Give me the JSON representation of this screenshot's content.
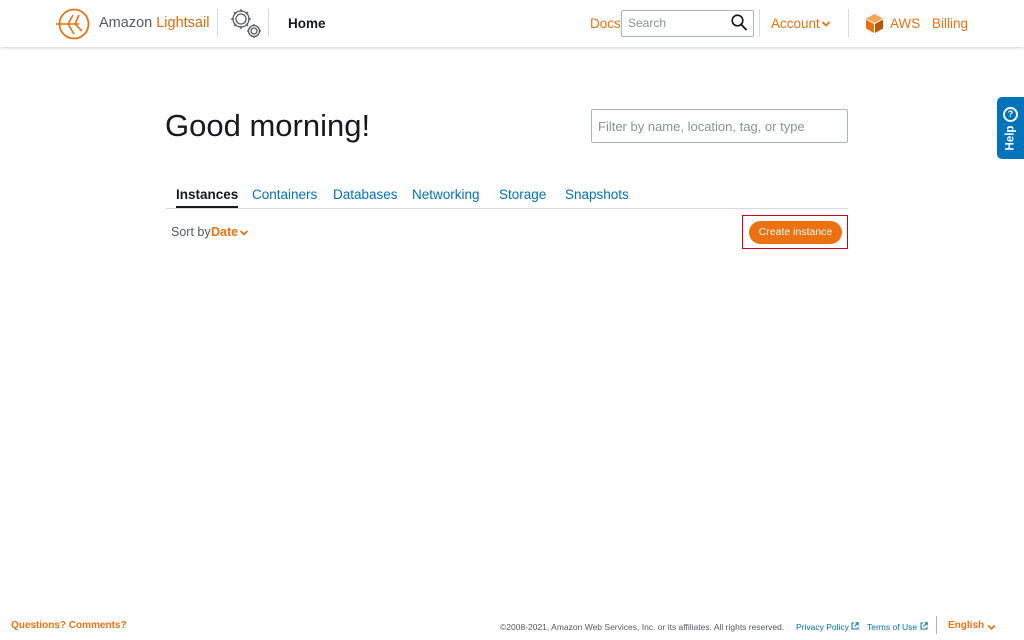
{
  "header": {
    "brand_prefix": "Amazon ",
    "brand_name": "Lightsail",
    "page": "Home",
    "docs_label": "Docs",
    "search_placeholder": "Search",
    "account_label": "Account",
    "aws_label": "AWS",
    "billing_label": "Billing"
  },
  "help_tab": {
    "label": "Help",
    "icon": "?"
  },
  "main": {
    "greeting": "Good morning!",
    "filter_placeholder": "Filter by name, location, tag, or type",
    "tabs": [
      {
        "label": "Instances",
        "active": true
      },
      {
        "label": "Containers",
        "active": false
      },
      {
        "label": "Databases",
        "active": false
      },
      {
        "label": "Networking",
        "active": false
      },
      {
        "label": "Storage",
        "active": false
      },
      {
        "label": "Snapshots",
        "active": false
      }
    ],
    "sort_label": "Sort by",
    "sort_value": "Date",
    "create_button": "Create instance"
  },
  "footer": {
    "questions": "Questions? Comments?",
    "copyright": "©2008-2021, Amazon Web Services, Inc. or its affiliates. All rights reserved.",
    "privacy": "Privacy Policy",
    "terms": "Terms of Use",
    "language": "English"
  },
  "colors": {
    "accent": "#ec7211",
    "link": "#0073bb",
    "help_tab": "#0073bb",
    "highlight_outline": "#d0021b"
  },
  "icons": {
    "logo": "lightsail-logo-icon",
    "settings": "gear-icon",
    "search": "search-icon",
    "aws": "aws-cube-icon",
    "external": "external-link-icon"
  }
}
